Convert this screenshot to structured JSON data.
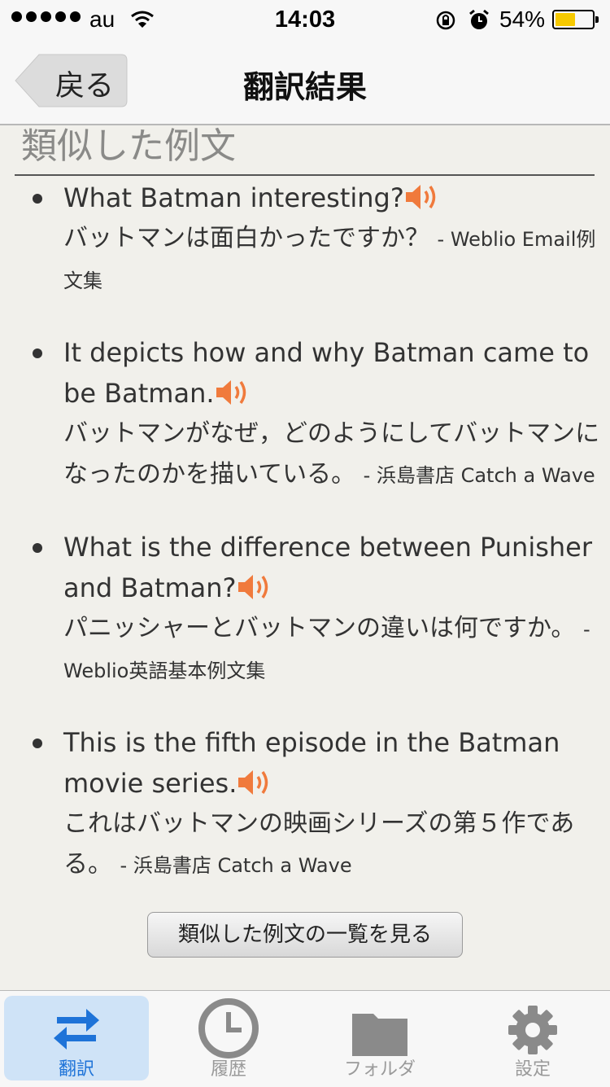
{
  "status_bar": {
    "carrier": "au",
    "time": "14:03",
    "battery_percent": "54%",
    "battery_level": 0.54
  },
  "nav": {
    "back_label": "戻る",
    "title": "翻訳結果"
  },
  "section": {
    "title": "類似した例文"
  },
  "examples": [
    {
      "en": "What Batman interesting?",
      "ja": "バットマンは面白かったですか？",
      "source": "- Weblio Email例文集"
    },
    {
      "en": "It depicts how and why Batman came to be Batman.",
      "ja": "バットマンがなぜ，どのようにしてバットマンになったのかを描いている。",
      "source": "- 浜島書店 Catch a Wave"
    },
    {
      "en": "What is the difference between Punisher and Batman?",
      "ja": "パニッシャーとバットマンの違いは何ですか。",
      "source": "- Weblio英語基本例文集"
    },
    {
      "en": "This is the fifth episode in the Batman movie series.",
      "ja": "これはバットマンの映画シリーズの第５作である。",
      "source": "- 浜島書店 Catch a Wave"
    }
  ],
  "more_button": "類似した例文の一覧を見る",
  "tabs": [
    {
      "label": "翻訳",
      "icon": "translate-arrows-icon",
      "active": true
    },
    {
      "label": "履歴",
      "icon": "clock-icon",
      "active": false
    },
    {
      "label": "フォルダ",
      "icon": "folder-icon",
      "active": false
    },
    {
      "label": "設定",
      "icon": "gear-icon",
      "active": false
    }
  ],
  "colors": {
    "background": "#f1f0eb",
    "speaker": "#f07a3c",
    "active_tab_bg": "#cfe3f7",
    "active_tab_text": "#1e73d8",
    "battery_fill": "#f6c900"
  }
}
